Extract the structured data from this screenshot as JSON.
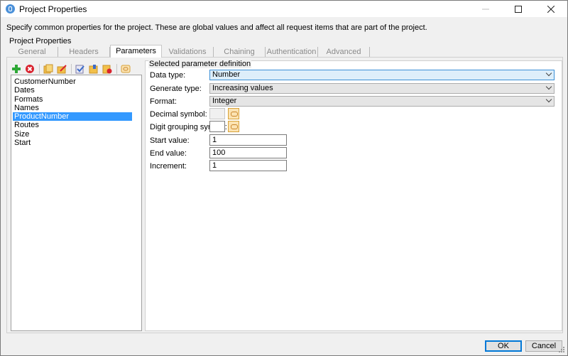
{
  "window": {
    "title": "Project Properties",
    "minimize_icon": "minimize-icon",
    "maximize_icon": "maximize-icon",
    "close_icon": "close-icon"
  },
  "description": "Specify common properties for the project. These are global values and affect all request items that are part of the project.",
  "group_title": "Project Properties",
  "tabs": [
    {
      "label": "General",
      "active": false
    },
    {
      "label": "Headers",
      "active": false
    },
    {
      "label": "Parameters",
      "active": true
    },
    {
      "label": "Validations",
      "active": false
    },
    {
      "label": "Chaining",
      "active": false
    },
    {
      "label": "Authentication",
      "active": false
    },
    {
      "label": "Advanced",
      "active": false
    }
  ],
  "toolbar": {
    "icons": [
      "add-icon",
      "delete-icon",
      "copy-icon",
      "edit-icon",
      "check-icon",
      "export-icon",
      "remove-icon",
      "symbol-icon"
    ]
  },
  "parameters": {
    "items": [
      "CustomerNumber",
      "Dates",
      "Formats",
      "Names",
      "ProductNumber",
      "Routes",
      "Size",
      "Start"
    ],
    "selected": "ProductNumber"
  },
  "detail": {
    "title": "Selected parameter definition",
    "data_type_label": "Data type:",
    "data_type_value": "Number",
    "generate_type_label": "Generate type:",
    "generate_type_value": "Increasing values",
    "format_label": "Format:",
    "format_value": "Integer",
    "decimal_symbol_label": "Decimal symbol:",
    "digit_grouping_label": "Digit grouping symbol:",
    "start_value_label": "Start value:",
    "start_value": "1",
    "end_value_label": "End value:",
    "end_value": "100",
    "increment_label": "Increment:",
    "increment_value": "1"
  },
  "buttons": {
    "ok": "OK",
    "cancel": "Cancel"
  },
  "colors": {
    "selection": "#3399ff",
    "focus_border": "#3b8fd6",
    "add_icon": "#2ea836",
    "delete_icon": "#d9232e",
    "folder_icon": "#f2c04a"
  }
}
